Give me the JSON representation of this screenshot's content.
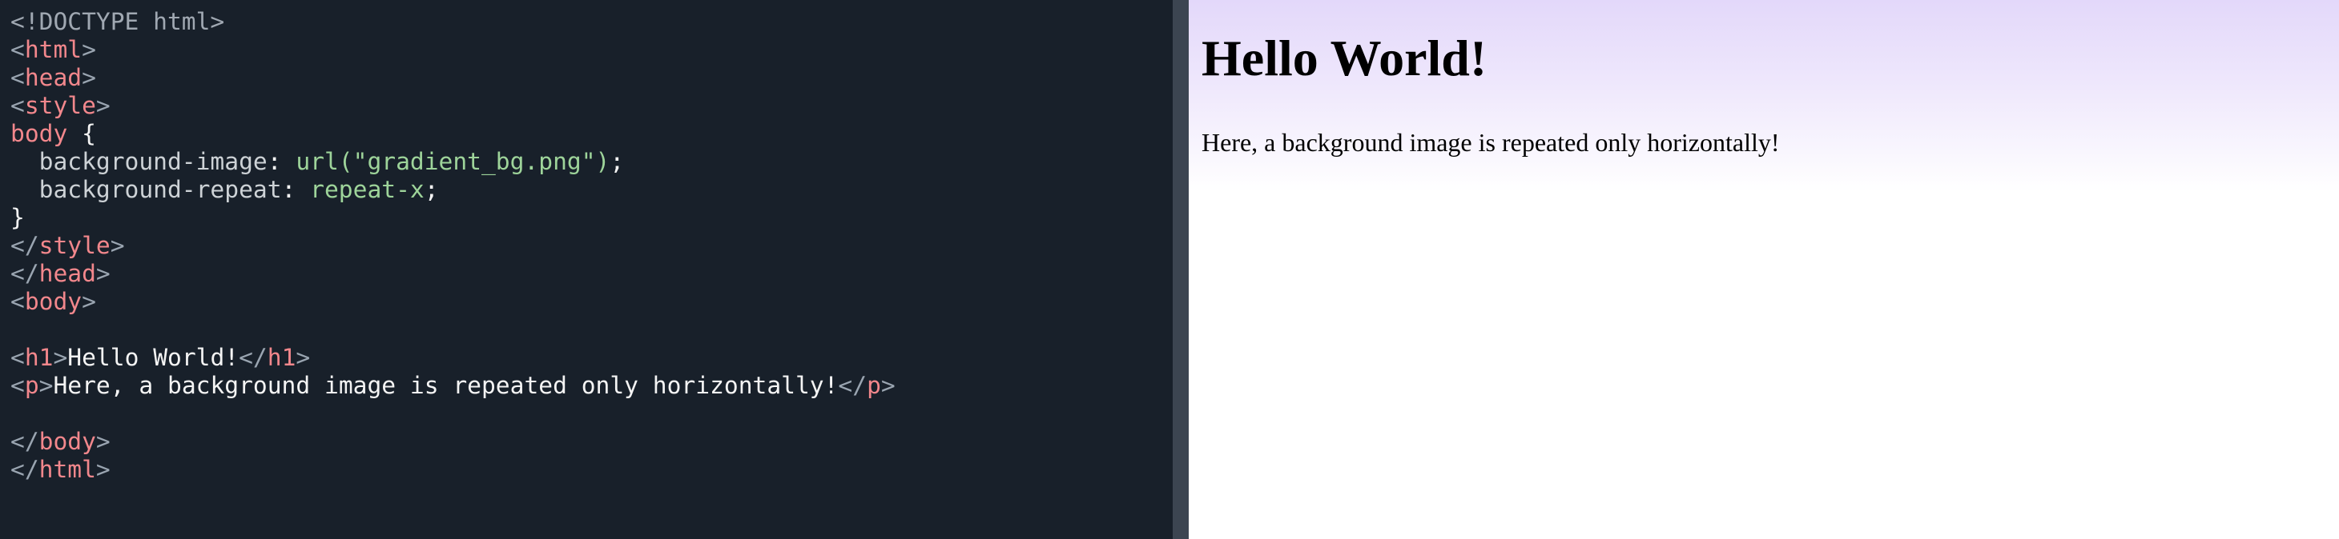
{
  "editor": {
    "lines": {
      "l1": "<!DOCTYPE html>",
      "l2_open": "<",
      "l2_tag": "html",
      "l2_close": ">",
      "l3_open": "<",
      "l3_tag": "head",
      "l3_close": ">",
      "l4_open": "<",
      "l4_tag": "style",
      "l4_close": ">",
      "l5_sel": "body",
      "l5_brace": " {",
      "l6_prop": "  background-image",
      "l6_colon": ": ",
      "l6_val": "url(\"gradient_bg.png\")",
      "l6_end": ";",
      "l7_prop": "  background-repeat",
      "l7_colon": ": ",
      "l7_val": "repeat-x",
      "l7_end": ";",
      "l8": "}",
      "l9_open": "</",
      "l9_tag": "style",
      "l9_close": ">",
      "l10_open": "</",
      "l10_tag": "head",
      "l10_close": ">",
      "l11_open": "<",
      "l11_tag": "body",
      "l11_close": ">",
      "l13_open": "<",
      "l13_tag": "h1",
      "l13_mid": ">",
      "l13_text": "Hello World!",
      "l13_end_open": "</",
      "l13_end_tag": "h1",
      "l13_end_close": ">",
      "l14_open": "<",
      "l14_tag": "p",
      "l14_mid": ">",
      "l14_text": "Here, a background image is repeated only horizontally!",
      "l14_end_open": "</",
      "l14_end_tag": "p",
      "l14_end_close": ">",
      "l16_open": "</",
      "l16_tag": "body",
      "l16_close": ">",
      "l17_open": "</",
      "l17_tag": "html",
      "l17_close": ">"
    }
  },
  "preview": {
    "heading": "Hello World!",
    "paragraph": "Here, a background image is repeated only horizontally!",
    "gradient_top_color": "#e3d8fa"
  },
  "colors": {
    "editor_bg": "#18202a",
    "divider": "#3c4551",
    "tag": "#f2878c",
    "value": "#9ed49a",
    "punctuation": "#9aa5b1"
  }
}
